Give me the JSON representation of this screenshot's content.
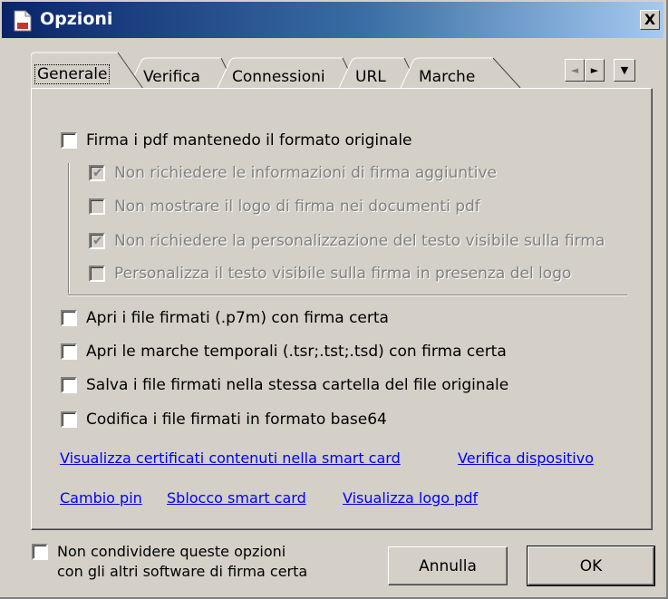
{
  "window": {
    "title": "Opzioni",
    "close_label": "X"
  },
  "tabs": [
    {
      "label": "Generale",
      "active": true
    },
    {
      "label": "Verifica",
      "active": false
    },
    {
      "label": "Connessioni",
      "active": false
    },
    {
      "label": "URL",
      "active": false
    },
    {
      "label": "Marche",
      "active": false
    }
  ],
  "tab_scroll": {
    "left": "◄",
    "right": "►",
    "menu": "▼"
  },
  "options": {
    "main": {
      "label": "Firma i pdf mantenedo il formato originale",
      "checked": false
    },
    "sub": [
      {
        "label": "Non richiedere le informazioni di firma aggiuntive",
        "checked": true,
        "disabled": true
      },
      {
        "label": "Non mostrare il logo di firma nei documenti pdf",
        "checked": false,
        "disabled": true
      },
      {
        "label": "Non richiedere la personalizzazione del testo visibile sulla firma",
        "checked": true,
        "disabled": true
      },
      {
        "label": "Personalizza il testo visibile sulla firma in presenza del logo",
        "checked": false,
        "disabled": true
      }
    ],
    "others": [
      {
        "label": "Apri i file firmati (.p7m) con firma certa",
        "checked": false
      },
      {
        "label": "Apri le marche temporali (.tsr;.tst;.tsd) con firma certa",
        "checked": false
      },
      {
        "label": "Salva i file firmati nella stessa cartella del file originale",
        "checked": false
      },
      {
        "label": "Codifica i file firmati in formato base64",
        "checked": false
      }
    ]
  },
  "links": {
    "view_certs": "Visualizza certificati contenuti nella smart card",
    "verify_device": "Verifica dispositivo",
    "change_pin": "Cambio pin",
    "unlock_card": "Sblocco smart card",
    "view_logo": "Visualizza logo pdf"
  },
  "footer": {
    "share_line1": "Non condividere queste opzioni",
    "share_line2": "con gli altri software di firma certa",
    "share_checked": false,
    "cancel_label": "Annulla",
    "ok_label": "OK"
  },
  "colors": {
    "dialog_bg": "#d4d0c8",
    "title_start": "#0a246a",
    "title_end": "#a6caf0",
    "link": "#0000ff"
  }
}
